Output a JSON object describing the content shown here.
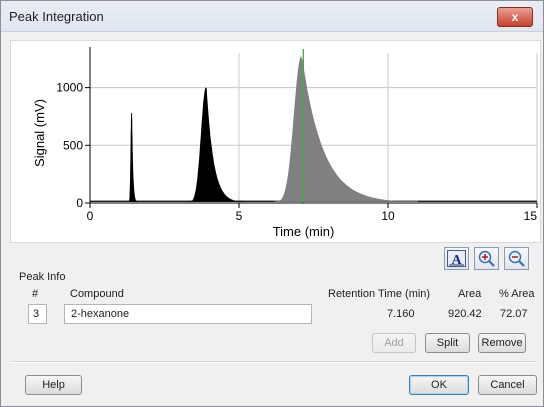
{
  "window": {
    "title": "Peak Integration",
    "close_glyph": "x"
  },
  "chart_data": {
    "type": "area",
    "xlabel": "Time (min)",
    "ylabel": "Signal (mV)",
    "xlim": [
      0,
      15
    ],
    "ylim": [
      0,
      1300
    ],
    "x_ticks": [
      0,
      5,
      10,
      15
    ],
    "y_ticks": [
      0,
      500,
      1000
    ],
    "grid": true,
    "peaks": [
      {
        "apex_x": 1.4,
        "apex_y": 780,
        "start_x": 1.3,
        "end_x": 1.6,
        "color": "#000000"
      },
      {
        "apex_x": 3.9,
        "apex_y": 1000,
        "start_x": 3.3,
        "end_x": 5.2,
        "color": "#000000"
      },
      {
        "apex_x": 7.1,
        "apex_y": 1270,
        "start_x": 6.2,
        "end_x": 11.0,
        "color": "#808080"
      }
    ],
    "baseline_y": 15,
    "marker": {
      "x": 7.16,
      "color": "#3cb043"
    }
  },
  "toolbar": {
    "icons": [
      "chart-label-icon",
      "zoom-in-icon",
      "zoom-out-icon"
    ]
  },
  "peak_info": {
    "label": "Peak Info",
    "headers": {
      "num": "#",
      "compound": "Compound",
      "rt": "Retention Time (min)",
      "area": "Area",
      "pct": "% Area"
    },
    "row": {
      "num": "3",
      "compound": "2-hexanone",
      "rt": "7.160",
      "area": "920.42",
      "pct": "72.07"
    }
  },
  "buttons": {
    "add": "Add",
    "split": "Split",
    "remove": "Remove",
    "help": "Help",
    "ok": "OK",
    "cancel": "Cancel"
  }
}
